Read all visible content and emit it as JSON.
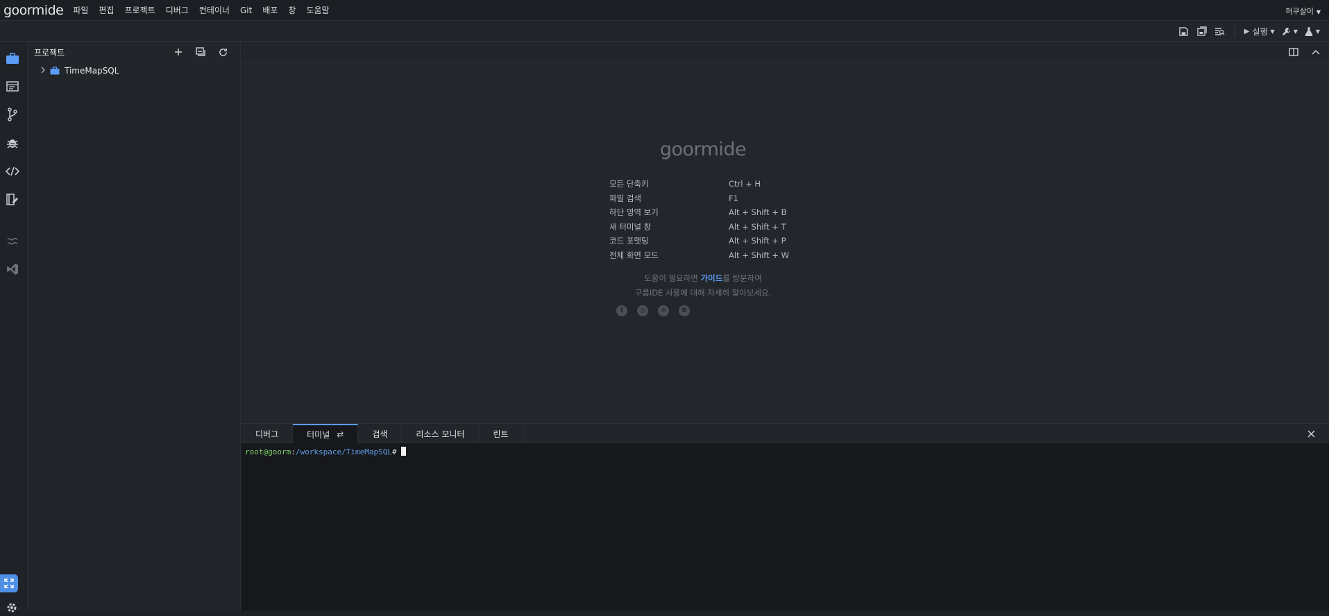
{
  "menubar": {
    "logo": "goormide",
    "items": [
      "파일",
      "편집",
      "프로젝트",
      "디버그",
      "컨테이너",
      "Git",
      "배포",
      "창",
      "도움말"
    ],
    "user": "허쿠살이"
  },
  "toolbar": {
    "run_label": "실행"
  },
  "sidebar": {
    "title": "프로젝트",
    "project": "TimeMapSQL"
  },
  "welcome": {
    "logo": "goormide",
    "shortcuts": [
      {
        "label": "모든 단축키",
        "keys": "Ctrl + H"
      },
      {
        "label": "파일 검색",
        "keys": "F1"
      },
      {
        "label": "하단 영역 보기",
        "keys": "Alt + Shift + B"
      },
      {
        "label": "새 터미널 창",
        "keys": "Alt + Shift + T"
      },
      {
        "label": "코드 포맷팅",
        "keys": "Alt + Shift + P"
      },
      {
        "label": "전체 화면 모드",
        "keys": "Alt + Shift + W"
      }
    ],
    "help_pre": "도움이 필요하면 ",
    "help_link": "가이드",
    "help_post": "를 방문하여",
    "help_line2": "구름IDE 사용에 대해 자세히 알아보세요."
  },
  "panel": {
    "tabs": [
      "디버그",
      "터미널",
      "검색",
      "리소스 모니터",
      "린트"
    ],
    "active_tab": "터미널"
  },
  "terminal": {
    "user": "root@goorm",
    "sep": ":",
    "path": "/workspace/TimeMapSQL",
    "prompt": "#"
  },
  "colors": {
    "accent": "#5b9cf6",
    "prompt_user": "#7dd36a",
    "prompt_path": "#5f9ee8"
  }
}
